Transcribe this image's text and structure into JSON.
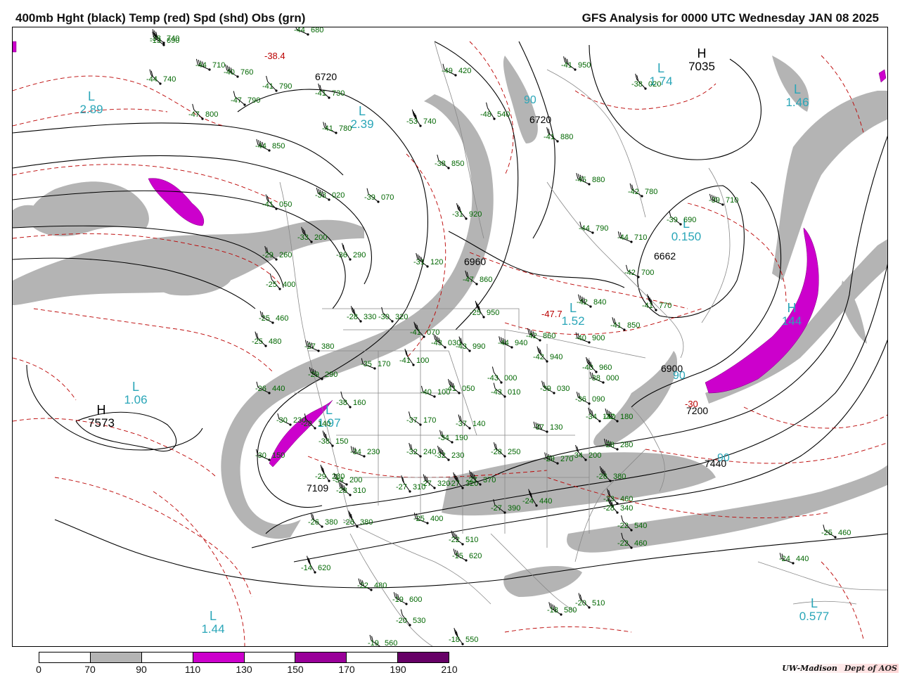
{
  "header": {
    "left_title": "400mb Hght (black) Temp (red) Spd (shd) Obs (grn)",
    "right_title": "GFS Analysis for 0000 UTC Wednesday  JAN 08 2025"
  },
  "legend": {
    "ticks": [
      "0",
      "70",
      "90",
      "110",
      "130",
      "150",
      "170",
      "190",
      "210"
    ],
    "colors": [
      "#ffffff",
      "#b4b4b4",
      "#ffffff",
      "#cc00cc",
      "#ffffff",
      "#990099",
      "#ffffff",
      "#660066"
    ]
  },
  "credit": {
    "org": "UW-Madison",
    "dept": "Dept of AOS"
  },
  "colors": {
    "height": "#000000",
    "temp": "#bb0000",
    "obs": "#006600",
    "centers": "#2aa6b8",
    "shade_gray": "#b4b4b4",
    "shade_mag": "#cc00cc"
  },
  "pressure_centers": [
    {
      "letter": "L",
      "value": "2.89"
    },
    {
      "letter": "L",
      "value": "1.06"
    },
    {
      "letter": "H",
      "value": "7573"
    },
    {
      "letter": "H",
      "value": "7035"
    },
    {
      "letter": "L",
      "value": "1.74"
    },
    {
      "letter": "L",
      "value": "1.46"
    },
    {
      "letter": "L",
      "value": "1.52"
    },
    {
      "letter": "L",
      "value": "0.150"
    },
    {
      "letter": "H",
      "value": "144"
    },
    {
      "letter": "L",
      "value": "1.97"
    },
    {
      "letter": "L",
      "value": "1.44"
    },
    {
      "letter": "L",
      "value": "0.577"
    },
    {
      "letter": "L",
      "value": "2.39"
    }
  ],
  "height_labels": [
    "6720",
    "6960",
    "6662",
    "6900",
    "7200",
    "7440",
    "7109",
    "6720"
  ],
  "speed_labels": [
    "90",
    "90",
    "90"
  ],
  "temp_labels": [
    "-38.4",
    "-47.7",
    "-30"
  ],
  "observations": [
    {
      "t": "-38",
      "h": "740"
    },
    {
      "t": "-44",
      "h": "680"
    },
    {
      "t": "-13",
      "h": "690"
    },
    {
      "t": "-44",
      "h": "710"
    },
    {
      "t": "-44",
      "h": "740"
    },
    {
      "t": "-40",
      "h": "760"
    },
    {
      "t": "-41",
      "h": "790"
    },
    {
      "t": "-47",
      "h": "790"
    },
    {
      "t": "-47",
      "h": "800"
    },
    {
      "t": "-41",
      "h": "730"
    },
    {
      "t": "-49",
      "h": "420"
    },
    {
      "t": "-53",
      "h": "740"
    },
    {
      "t": "-41",
      "h": "780"
    },
    {
      "t": "-48",
      "h": "540"
    },
    {
      "t": "-41",
      "h": "950"
    },
    {
      "t": "-38",
      "h": "020"
    },
    {
      "t": "-44",
      "h": "850"
    },
    {
      "t": "-38",
      "h": "850"
    },
    {
      "t": "-41",
      "h": "880"
    },
    {
      "t": "-45",
      "h": "880"
    },
    {
      "t": "-42",
      "h": "780"
    },
    {
      "t": "-39",
      "h": "710"
    },
    {
      "t": "-33",
      "h": "020"
    },
    {
      "t": "-39",
      "h": "070"
    },
    {
      "t": "-41",
      "h": "050"
    },
    {
      "t": "-31",
      "h": "920"
    },
    {
      "t": "-44",
      "h": "790"
    },
    {
      "t": "-39",
      "h": "690"
    },
    {
      "t": "-44",
      "h": "710"
    },
    {
      "t": "-33",
      "h": "200"
    },
    {
      "t": "-36",
      "h": "290"
    },
    {
      "t": "-29",
      "h": "260"
    },
    {
      "t": "-31",
      "h": "120"
    },
    {
      "t": "-47",
      "h": "860"
    },
    {
      "t": "-42",
      "h": "700"
    },
    {
      "t": "-25",
      "h": "400"
    },
    {
      "t": "-42",
      "h": "840"
    },
    {
      "t": "-41",
      "h": "770"
    },
    {
      "t": "-25",
      "h": "950"
    },
    {
      "t": "-28",
      "h": "330"
    },
    {
      "t": "-30",
      "h": "320"
    },
    {
      "t": "-41",
      "h": "850"
    },
    {
      "t": "-25",
      "h": "460"
    },
    {
      "t": "-41",
      "h": "070"
    },
    {
      "t": "-42",
      "h": "860"
    },
    {
      "t": "-40",
      "h": "900"
    },
    {
      "t": "-25",
      "h": "480"
    },
    {
      "t": "-27",
      "h": "380"
    },
    {
      "t": "-43",
      "h": "030"
    },
    {
      "t": "-43",
      "h": "990"
    },
    {
      "t": "-44",
      "h": "940"
    },
    {
      "t": "-41",
      "h": "100"
    },
    {
      "t": "-35",
      "h": "170"
    },
    {
      "t": "-42",
      "h": "940"
    },
    {
      "t": "-40",
      "h": "960"
    },
    {
      "t": "-29",
      "h": "290"
    },
    {
      "t": "-26",
      "h": "440"
    },
    {
      "t": "-40",
      "h": "100"
    },
    {
      "t": "-41",
      "h": "050"
    },
    {
      "t": "-43",
      "h": "000"
    },
    {
      "t": "-43",
      "h": "010"
    },
    {
      "t": "-39",
      "h": "030"
    },
    {
      "t": "-38",
      "h": "000"
    },
    {
      "t": "-36",
      "h": "090"
    },
    {
      "t": "-38",
      "h": "160"
    },
    {
      "t": "-30",
      "h": "230"
    },
    {
      "t": "-28",
      "h": "140"
    },
    {
      "t": "-37",
      "h": "170"
    },
    {
      "t": "-37",
      "h": "140"
    },
    {
      "t": "-37",
      "h": "130"
    },
    {
      "t": "-34",
      "h": "140"
    },
    {
      "t": "-32",
      "h": "180"
    },
    {
      "t": "-38",
      "h": "150"
    },
    {
      "t": "-34",
      "h": "190"
    },
    {
      "t": "-28",
      "h": "280"
    },
    {
      "t": "-30",
      "h": "150"
    },
    {
      "t": "-34",
      "h": "200"
    },
    {
      "t": "-34",
      "h": "230"
    },
    {
      "t": "-32",
      "h": "240"
    },
    {
      "t": "-32",
      "h": "230"
    },
    {
      "t": "-28",
      "h": "250"
    },
    {
      "t": "-29",
      "h": "270"
    },
    {
      "t": "-34",
      "h": "200"
    },
    {
      "t": "-29",
      "h": "280"
    },
    {
      "t": "-28",
      "h": "310"
    },
    {
      "t": "-27",
      "h": "310"
    },
    {
      "t": "-27",
      "h": "320"
    },
    {
      "t": "-27",
      "h": "320"
    },
    {
      "t": "-27",
      "h": "370"
    },
    {
      "t": "-26",
      "h": "380"
    },
    {
      "t": "-27",
      "h": "390"
    },
    {
      "t": "-24",
      "h": "440"
    },
    {
      "t": "-23",
      "h": "460"
    },
    {
      "t": "-28",
      "h": "340"
    },
    {
      "t": "-26",
      "h": "380"
    },
    {
      "t": "-26",
      "h": "380"
    },
    {
      "t": "-25",
      "h": "400"
    },
    {
      "t": "-22",
      "h": "510"
    },
    {
      "t": "-22",
      "h": "540"
    },
    {
      "t": "-22",
      "h": "460"
    },
    {
      "t": "-15",
      "h": "620"
    },
    {
      "t": "-25",
      "h": "460"
    },
    {
      "t": "-14",
      "h": "620"
    },
    {
      "t": "-24",
      "h": "440"
    },
    {
      "t": "-22",
      "h": "480"
    },
    {
      "t": "-19",
      "h": "600"
    },
    {
      "t": "-18",
      "h": "580"
    },
    {
      "t": "-20",
      "h": "510"
    },
    {
      "t": "-20",
      "h": "530"
    },
    {
      "t": "-19",
      "h": "560"
    },
    {
      "t": "-18",
      "h": "550"
    }
  ]
}
